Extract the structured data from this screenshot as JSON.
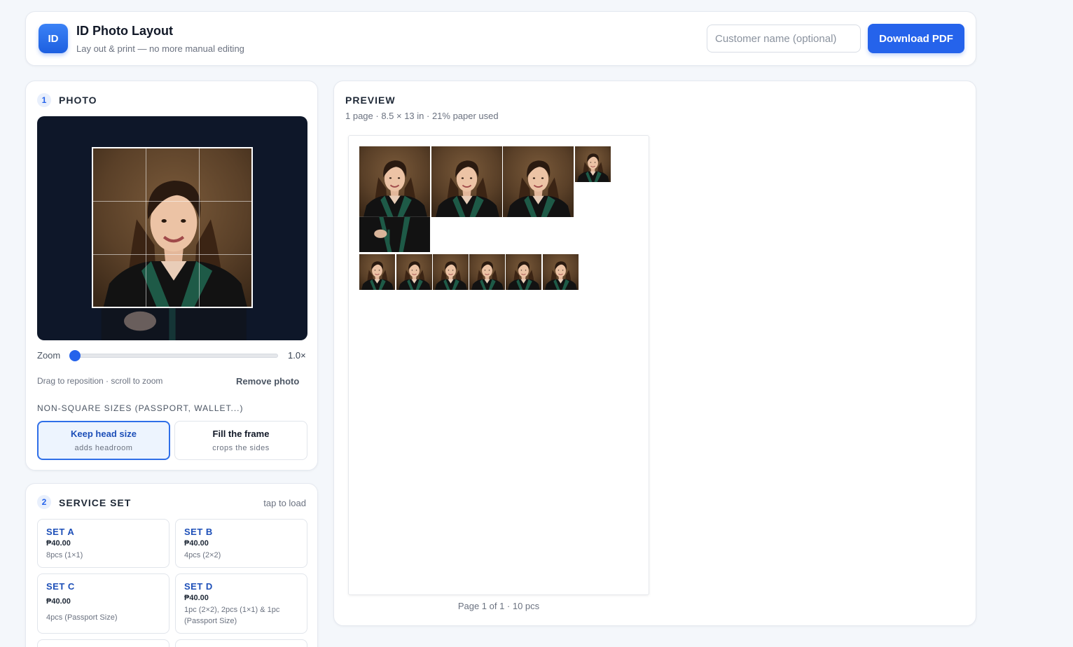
{
  "header": {
    "logo_text": "ID",
    "title": "ID Photo Layout",
    "subtitle": "Lay out & print — no more manual editing",
    "customer_placeholder": "Customer name (optional)",
    "download_label": "Download PDF"
  },
  "photo_section": {
    "number": "1",
    "title": "PHOTO",
    "zoom_label": "Zoom",
    "zoom_value": "1.0×",
    "zoom_level": 1.0,
    "hint": "Drag to reposition · scroll to zoom",
    "remove_label": "Remove photo",
    "nonsquare_heading": "NON-SQUARE SIZES (PASSPORT, WALLET...)",
    "options": [
      {
        "title": "Keep head size",
        "subtitle": "adds headroom",
        "selected": true
      },
      {
        "title": "Fill the frame",
        "subtitle": "crops the sides",
        "selected": false
      }
    ]
  },
  "service_section": {
    "number": "2",
    "title": "SERVICE SET",
    "hint": "tap to load",
    "sets": [
      {
        "name": "SET A",
        "price": "₱40.00",
        "desc": "8pcs (1×1)"
      },
      {
        "name": "SET B",
        "price": "₱40.00",
        "desc": "4pcs (2×2)"
      },
      {
        "name": "SET C",
        "price": "₱40.00",
        "desc": "4pcs (Passport Size)"
      },
      {
        "name": "SET D",
        "price": "₱40.00",
        "desc": "1pc (2×2), 2pcs (1×1) & 1pc (Passport Size)"
      }
    ]
  },
  "preview": {
    "title": "PREVIEW",
    "meta": "1 page · 8.5 × 13 in · 21% paper used",
    "caption": "Page 1 of 1 · 10 pcs"
  },
  "colors": {
    "accent": "#2563eb",
    "editor_background": "#0e1729",
    "photo_background": "#5a4028",
    "toga_green": "#1e5a47"
  },
  "icons": {
    "portrait": "graduation-portrait-icon"
  }
}
